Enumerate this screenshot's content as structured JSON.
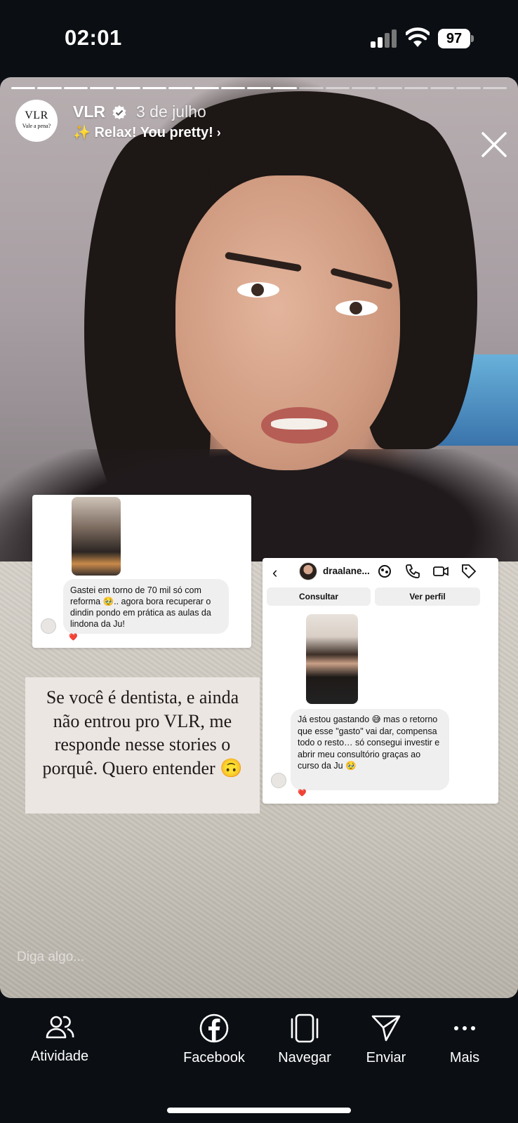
{
  "status_bar": {
    "time": "02:01",
    "battery": "97"
  },
  "story": {
    "account": "VLR",
    "avatar_line1": "VLR",
    "avatar_line2": "Vale a pena?",
    "date": "3 de julho",
    "music": "Relax! You pretty!",
    "progress_segments_total": 19,
    "progress_segments_done": 11,
    "reply_placeholder": "Diga algo..."
  },
  "card1": {
    "message": "Gastei em torno de 70 mil só com reforma 🥹.. agora bora recuperar o dindin  pondo em prática as aulas da lindona da Ju!",
    "reaction": "❤️"
  },
  "card2": {
    "username": "draalane...",
    "back_glyph": "‹",
    "buttons": [
      "Consultar",
      "Ver perfil"
    ],
    "message": "Já estou gastando 😅 mas o retorno que esse \"gasto\" vai dar, compensa todo o resto… só consegui investir e abrir meu consultório graças ao curso da Ju 🥹",
    "reaction": "❤️"
  },
  "quote": {
    "text": "Se você é dentista, e ainda não entrou pro VLR, me responde nesse stories o porquê. Quero entender 🙃"
  },
  "bottom_bar": {
    "actions": [
      {
        "label": "Atividade",
        "icon": "people-icon"
      },
      {
        "label": "Facebook",
        "icon": "facebook-icon"
      },
      {
        "label": "Navegar",
        "icon": "phone-frame-icon"
      },
      {
        "label": "Enviar",
        "icon": "send-icon"
      },
      {
        "label": "Mais",
        "icon": "more-icon"
      }
    ]
  }
}
